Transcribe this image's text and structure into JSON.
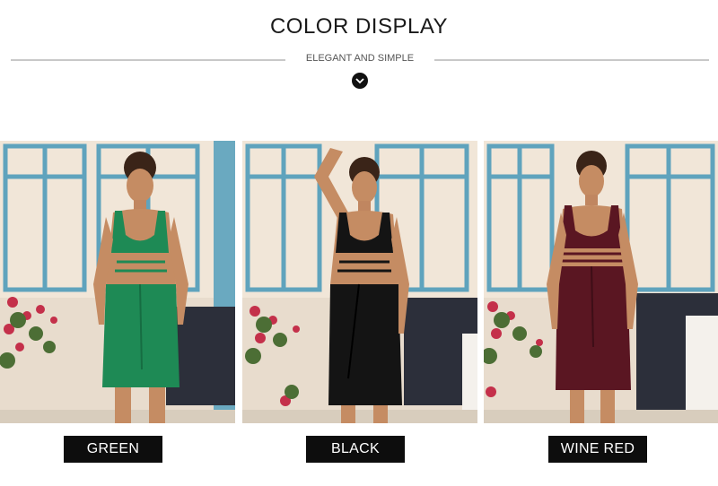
{
  "header": {
    "title": "COLOR DISPLAY",
    "subtitle": "ELEGANT AND SIMPLE"
  },
  "variants": [
    {
      "label": "GREEN",
      "color": "#1e8a55"
    },
    {
      "label": "BLACK",
      "color": "#141414"
    },
    {
      "label": "WINE RED",
      "color": "#5a1622"
    }
  ],
  "icons": {
    "scroll": "chevron-down-icon"
  }
}
